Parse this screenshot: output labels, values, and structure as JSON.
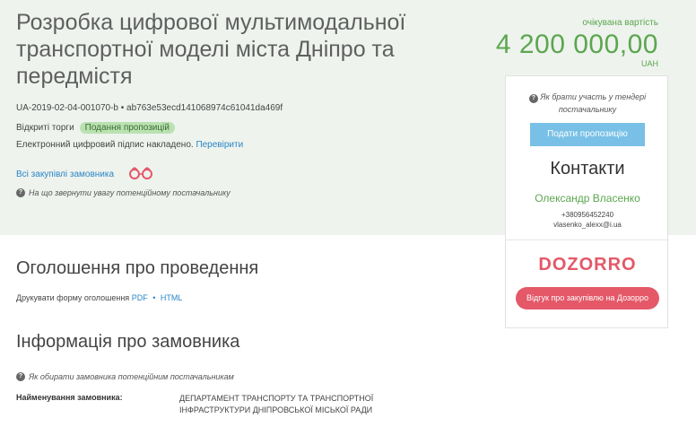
{
  "tender": {
    "title": "Розробка цифрової мультимодальної транспортної моделі міста Дніпро та передмістя",
    "id": "UA-2019-02-04-001070-b",
    "separator": "•",
    "hash": "ab763e53ecd141068974c61041da469f",
    "procedure": "Відкриті торги",
    "status": "Подання пропозицій",
    "signature_text": "Електронний цифровий підпис накладено.",
    "verify_link": "Перевірити",
    "all_purchases_link": "Всі закупівлі замовника",
    "attention_text": "На що звернути увагу потенційному постачальнику"
  },
  "value": {
    "label": "очікувана вартість",
    "amount": "4 200 000,00",
    "currency": "UAH"
  },
  "side_panel": {
    "how_to_participate": "Як брати участь у тендері постачальнику",
    "submit_button": "Подати пропозицію",
    "contacts_title": "Контакти",
    "contact_name": "Олександр Власенко",
    "contact_phone": "+380956452240",
    "contact_email": "vlasenko_alexx@i.ua",
    "dozorro_logo": "DOZORRO",
    "dozorro_button": "Відгук про закупівлю на Дозорро"
  },
  "announcement": {
    "title": "Оголошення про проведення",
    "print_text": "Друкувати форму оголошення",
    "pdf_link": "PDF",
    "dot": "•",
    "html_link": "HTML"
  },
  "customer": {
    "title": "Інформація про замовника",
    "choose_text": "Як обирати замовника потенційним постачальникам",
    "name_label": "Найменування замовника:",
    "name_value": "ДЕПАРТАМЕНТ ТРАНСПОРТУ ТА ТРАНСПОРТНОЇ ІНФРАСТРУКТУРИ ДНІПРОВСЬКОЇ МІСЬКОЇ РАДИ"
  },
  "colors": {
    "accent_green": "#5ca64f",
    "link_blue": "#2a86c6",
    "dozorro_red": "#e45868",
    "header_bg": "#eef3ee"
  },
  "icons": [
    "binoculars-icon",
    "help-icon"
  ]
}
